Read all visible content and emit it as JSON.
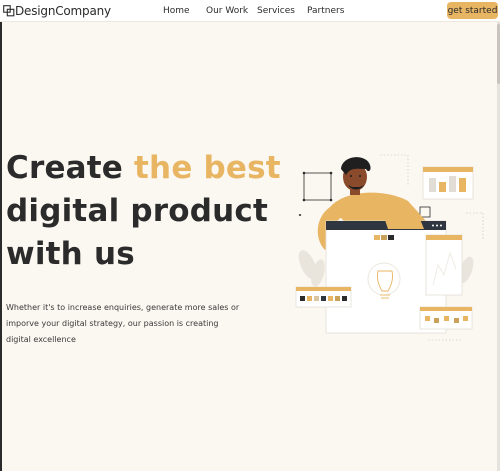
{
  "brand": {
    "name": "DesignCompany",
    "logo_icon": "layered-squares-icon"
  },
  "nav": {
    "links": [
      "Home",
      "Our Work",
      "Services",
      "Partners"
    ],
    "cta_label": "get started"
  },
  "hero": {
    "title_line1_plain": "Create ",
    "title_line1_accent": "the best",
    "title_line2": "digital product",
    "title_line3": "with us",
    "description": "Whether it's to increase enquiries, generate more sales or imporve your digital strategy, our passion is creating digital excellence"
  },
  "colors": {
    "accent": "#e8b563",
    "text": "#2b2b2b",
    "background": "#fbf7f1"
  },
  "illustration": {
    "icon": "designer-presenting-board-illustration"
  }
}
